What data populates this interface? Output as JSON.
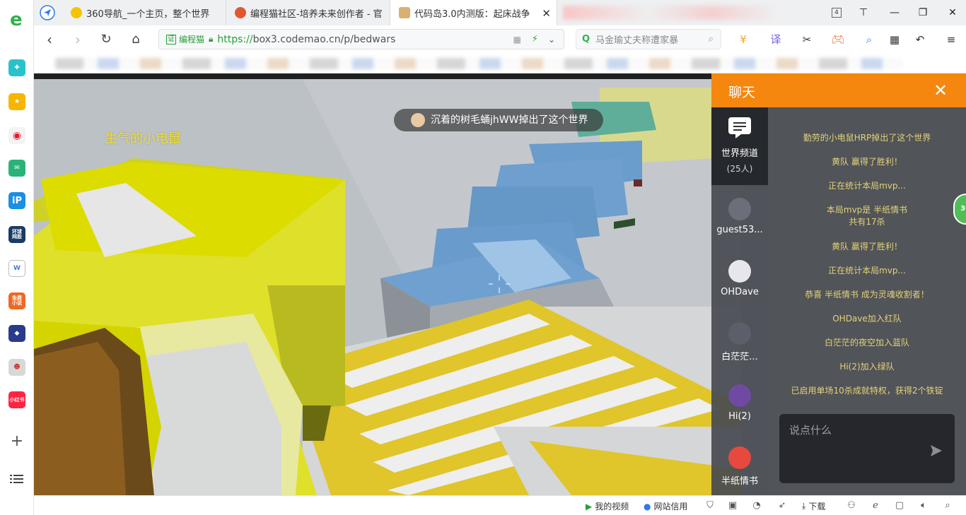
{
  "browser": {
    "tabs": [
      {
        "title": "360导航_一个主页，整个世界",
        "active": false
      },
      {
        "title": "编程猫社区-培养未来创作者 - 官",
        "active": false
      },
      {
        "title": "代码岛3.0内测版：起床战争",
        "active": true
      }
    ],
    "tab_count": "4",
    "url_cert": "编程猫",
    "url_https": "https://",
    "url_rest": "box3.codemao.cn/p/bedwars",
    "search_placeholder": "马金瑜丈夫称遭家暴"
  },
  "sidebar": {
    "items": [
      {
        "icon": "browser-e-logo",
        "color": "#2fb24a"
      },
      {
        "icon": "app-plus-icon",
        "color": "#28c3c9"
      },
      {
        "icon": "favorites-star-icon",
        "color": "#f7b500"
      },
      {
        "icon": "weibo-icon",
        "color": "#e6162d"
      },
      {
        "icon": "mail-icon",
        "color": "#2ab27b"
      },
      {
        "icon": "ip-icon",
        "color": "#1a8fe3"
      },
      {
        "icon": "news-icon",
        "color": "#1b3a63",
        "label": "环球\n网股"
      },
      {
        "icon": "doc-icon",
        "color": "#3f7fd8"
      },
      {
        "icon": "novel-icon",
        "color": "#ee6a24",
        "label": "免费\n小说"
      },
      {
        "icon": "game-icon",
        "color": "#2a3b8c"
      },
      {
        "icon": "anime-icon",
        "color": "#d8d8d8"
      },
      {
        "icon": "xiaohongshu-icon",
        "color": "#ff2442",
        "label": "小红书"
      }
    ]
  },
  "game": {
    "player_name": "生气的小电鼠",
    "notice": "沉着的树毛蛹jhWW掉出了这个世界"
  },
  "chat": {
    "title": "聊天",
    "channel_name": "世界频道",
    "channel_count": "(25人)",
    "users": [
      {
        "name": "guest53...",
        "color": "#6b6f7a"
      },
      {
        "name": "OHDave",
        "color": "#e6e6ec"
      },
      {
        "name": "白茫茫...",
        "color": "#5b5f6a"
      },
      {
        "name": "Hi(2)",
        "color": "#6f4aa3"
      },
      {
        "name": "半纸情书",
        "color": "#e8493e"
      }
    ],
    "messages": [
      "勤劳的小电鼠HRP掉出了这个世界",
      "黄队 赢得了胜利！",
      "正在统计本局mvp...",
      "本局mvp是 半纸情书\n共有17杀",
      "黄队 赢得了胜利！",
      "正在统计本局mvp...",
      "恭喜 半纸情书 成为灵魂收割者！",
      "OHDave加入红队",
      "白茫茫的夜空加入蓝队",
      "Hi(2)加入绿队",
      "已启用单场10杀成就特权，获得2个铁锭"
    ],
    "input_placeholder": "说点什么",
    "side_badge": "360"
  },
  "statusbar": {
    "my_video": "我的视频",
    "site_credit": "网站信用",
    "download": "下载"
  }
}
